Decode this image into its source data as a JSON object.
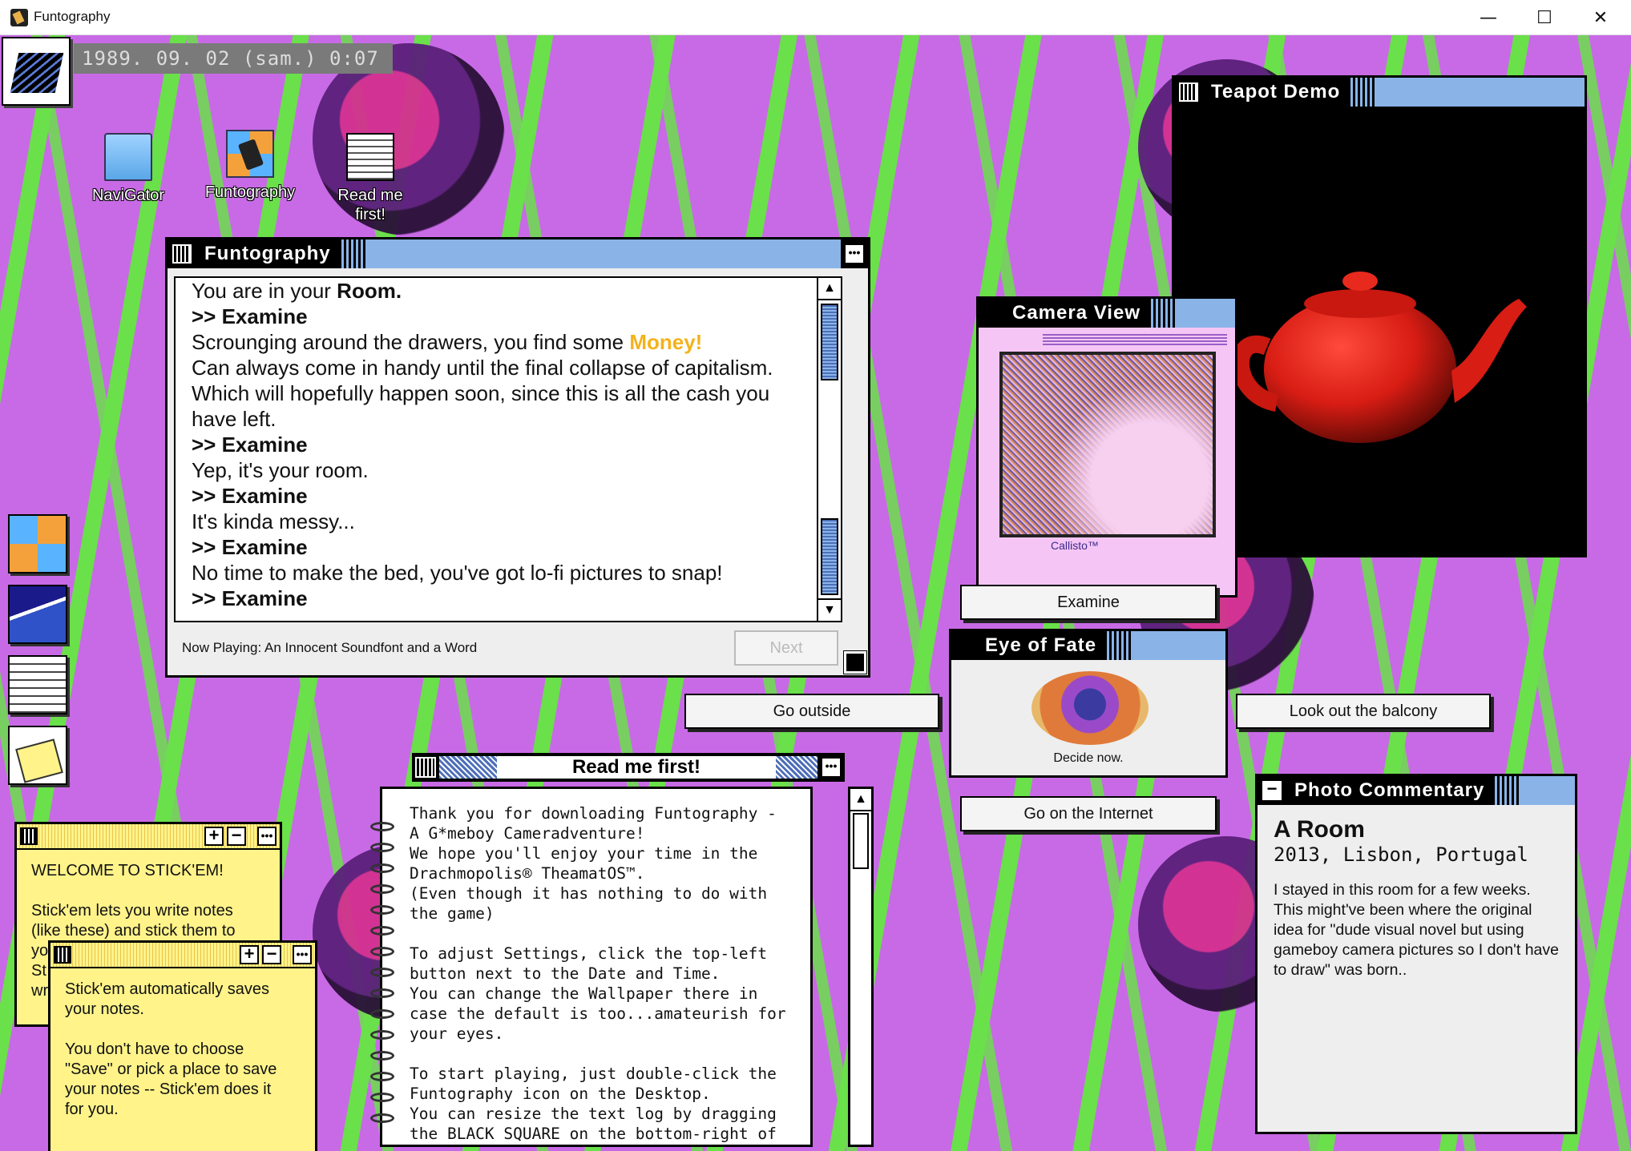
{
  "window": {
    "title": "Funtography",
    "minimize": "—",
    "maximize": "☐",
    "close": "✕"
  },
  "clock": "1989. 09. 02 (sam.) 0:07",
  "desktop_icons": [
    {
      "label": "NaviGator",
      "icon": "folder-icon"
    },
    {
      "label": "Funtography",
      "icon": "camera-icon"
    },
    {
      "label": "Read me first!",
      "icon": "news-icon"
    }
  ],
  "funtography": {
    "title": "Funtography",
    "log": [
      {
        "type": "text",
        "before": "You are in your ",
        "bold": "Room."
      },
      {
        "type": "cmd",
        "text": ">> Examine"
      },
      {
        "type": "money",
        "before": "Scrounging around the drawers, you find some ",
        "highlight": "Money!"
      },
      {
        "type": "text",
        "before": "Can always come in handy until the final collapse of capitalism."
      },
      {
        "type": "text",
        "before": "Which will hopefully happen soon, since this is all the cash you"
      },
      {
        "type": "text",
        "before": "have left."
      },
      {
        "type": "cmd",
        "text": ">> Examine"
      },
      {
        "type": "text",
        "before": "Yep, it's your room."
      },
      {
        "type": "cmd",
        "text": ">> Examine"
      },
      {
        "type": "text",
        "before": "It's kinda messy..."
      },
      {
        "type": "cmd",
        "text": ">> Examine"
      },
      {
        "type": "text",
        "before": "No time to make the bed, you've got lo-fi pictures to snap!"
      },
      {
        "type": "cmd",
        "text": ">> Examine"
      }
    ],
    "status": "Now Playing: An Innocent Soundfont and a Word",
    "next_label": "Next"
  },
  "camera_view": {
    "title": "Camera View",
    "brand": "Callisto™"
  },
  "teapot": {
    "title": "Teapot Demo"
  },
  "eye_of_fate": {
    "title": "Eye of Fate",
    "caption": "Decide now."
  },
  "actions": {
    "examine": "Examine",
    "go_outside": "Go outside",
    "look_balcony": "Look out the balcony",
    "go_internet": "Go on the Internet"
  },
  "readme": {
    "title": "Read me first!",
    "text": "Thank you for downloading Funtography -\nA G*meboy Cameradventure!\nWe hope you'll enjoy your time in the\nDrachmopolis® TheamatOS™.\n(Even though it has nothing to do with\nthe game)\n\nTo adjust Settings, click the top-left\nbutton next to the Date and Time.\nYou can change the Wallpaper there in\ncase the default is too...amateurish for\nyour eyes.\n\nTo start playing, just double-click the\nFuntography icon on the Desktop.\nYou can resize the text log by dragging\nthe BLACK SQUARE on the bottom-right of"
  },
  "sticky1": {
    "text": "WELCOME TO STICK'EM!\n\nStick'em lets you write notes\n(like these) and stick them to\nyo\nSt\nwr"
  },
  "sticky2": {
    "text": "Stick'em automatically saves\nyour notes.\n\nYou don't have to choose\n\"Save\" or pick a place to save\nyour notes -- Stick'em does it\nfor you."
  },
  "photo_commentary": {
    "title": "Photo Commentary",
    "heading": "A Room",
    "sub": "2013, Lisbon, Portugal",
    "text": "I stayed in this room for a few weeks. This might've been where the original idea for \"dude visual novel but using gameboy camera pictures so I don't have to draw\" was born.."
  },
  "colors": {
    "wallpaper": "#c86ae6",
    "waves": "#6ae04a",
    "title_accent": "#8ab4e8",
    "money": "#f3b31c",
    "sticky": "#fff38a",
    "teapot": "#e8221c"
  }
}
